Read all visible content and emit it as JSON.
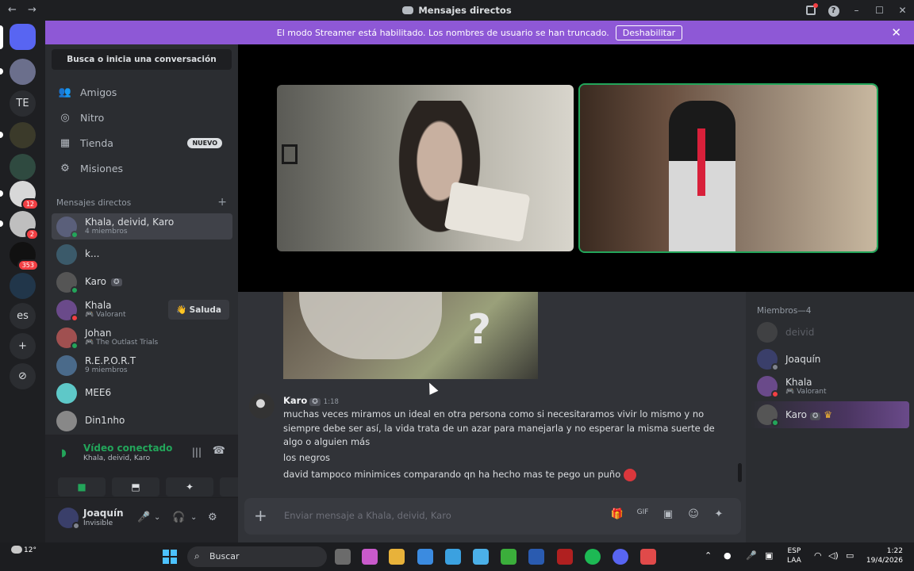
{
  "titlebar": {
    "back": "←",
    "forward": "→",
    "title": "Mensajes directos",
    "inbox_icon": "inbox-icon",
    "help": "?",
    "minimize": "–",
    "maximize": "☐",
    "close": "✕"
  },
  "banner": {
    "text": "El modo Streamer está habilitado. Los nombres de usuario se han truncado.",
    "button": "Deshabilitar",
    "close": "✕"
  },
  "guilds": [
    {
      "label": "",
      "color": "#5865f2",
      "badge": ""
    },
    {
      "label": "",
      "color": "#6b6f8c",
      "badge": ""
    },
    {
      "label": "TE",
      "color": "#2b2d31",
      "badge": ""
    },
    {
      "label": "",
      "color": "#3b3a2a",
      "badge": ""
    },
    {
      "label": "",
      "color": "#2f4a40",
      "badge": ""
    },
    {
      "label": "",
      "color": "#d8d8d8",
      "badge": "12"
    },
    {
      "label": "",
      "color": "#bfbfbf",
      "badge": "2"
    },
    {
      "label": "",
      "color": "#111111",
      "badge": "353"
    },
    {
      "label": "",
      "color": "#21364a",
      "badge": ""
    },
    {
      "label": "es",
      "color": "#2b2d31",
      "badge": ""
    },
    {
      "label": "+",
      "color": "#2b2d31",
      "badge": ""
    },
    {
      "label": "⊘",
      "color": "#2b2d31",
      "badge": ""
    }
  ],
  "sidebar": {
    "search": "Busca o inicia una conversación",
    "nav": [
      {
        "label": "Amigos",
        "icon": "👥",
        "new": ""
      },
      {
        "label": "Nitro",
        "icon": "◎",
        "new": ""
      },
      {
        "label": "Tienda",
        "icon": "▦",
        "new": "NUEVO"
      },
      {
        "label": "Misiones",
        "icon": "⚙",
        "new": ""
      }
    ],
    "dm_header": "Mensajes directos",
    "dm_plus": "+",
    "dms": [
      {
        "name": "Khala, deivid, Karo",
        "sub": "4 miembros",
        "game": "",
        "color": "#5a5f7a",
        "status": "#23a55a"
      },
      {
        "name": "k...",
        "sub": "",
        "game": "",
        "color": "#3b5a6a",
        "status": ""
      },
      {
        "name": "Karo",
        "sub": "",
        "game": "",
        "color": "#555555",
        "status": "#23a55a"
      },
      {
        "name": "Khala",
        "sub": "Valorant",
        "game": "🎮",
        "color": "#6a4a8a",
        "status": "#f23f43"
      },
      {
        "name": "Johan",
        "sub": "The Outlast Trials",
        "game": "🎮",
        "color": "#a05050",
        "status": "#23a55a"
      },
      {
        "name": "R.E.P.O.R.T",
        "sub": "9 miembros",
        "game": "",
        "color": "#4a6a8a",
        "status": ""
      },
      {
        "name": "MEE6",
        "sub": "",
        "game": "",
        "color": "#5ec8c8",
        "status": ""
      },
      {
        "name": "Din1nho",
        "sub": "",
        "game": "",
        "color": "#888888",
        "status": ""
      }
    ],
    "wave_button": "👋 Saluda"
  },
  "voice": {
    "title": "Vídeo conectado",
    "sub": "Khala, deivid, Karo",
    "wifi": "◗",
    "sound": "|||",
    "leave": "☎",
    "buttons": [
      "■",
      "⬒",
      "✦",
      "☼"
    ]
  },
  "user": {
    "name": "Joaquín",
    "status": "Invisible",
    "mic": "🎤",
    "head": "🎧",
    "gear": "⚙",
    "chev": "⌄"
  },
  "chat": {
    "author": "Karo",
    "tag": "✪",
    "time": "1:18",
    "lines": [
      "muchas veces miramos un ideal en otra persona como si necesitaramos vivir lo mismo y no siempre debe ser así, la vida trata de un azar para manejarla y no esperar la misma suerte de algo o alguien más",
      "los negros",
      "david tampoco minimices comparando qn ha hecho mas te pego un puño"
    ],
    "image_text": "?",
    "composer_placeholder": "Enviar mensaje a Khala, deivid, Karo",
    "composer_plus": "+",
    "tools": [
      "🎁",
      "GIF",
      "▣",
      "☺",
      "✦"
    ]
  },
  "members": {
    "header": "Miembros—4",
    "list": [
      {
        "name": "deivid",
        "sub": "",
        "color": "#555555",
        "status": "",
        "dim": true
      },
      {
        "name": "Joaquín",
        "sub": "",
        "color": "#3a3f6a",
        "status": "#80848e",
        "dim": false
      },
      {
        "name": "Khala",
        "sub": "Valorant",
        "color": "#6a4a8a",
        "status": "#f23f43",
        "dim": false
      },
      {
        "name": "Karo",
        "sub": "",
        "color": "#555555",
        "status": "#23a55a",
        "dim": false,
        "crown": "♛"
      }
    ]
  },
  "taskbar": {
    "weather": "12°",
    "search": "Buscar",
    "search_icon": "⌕",
    "lang1": "ESP",
    "lang2": "LAA",
    "time": "1:22",
    "date": "19/4/2026",
    "apps": [
      "#6b6b6b",
      "#c95acb",
      "#e8b23a",
      "#3b8be0",
      "#3ba1e0",
      "#4bb0e8",
      "#3bae3b",
      "#2a5bb0",
      "#b02020",
      "#1db954",
      "#5865f2",
      "#e04a4a"
    ]
  }
}
